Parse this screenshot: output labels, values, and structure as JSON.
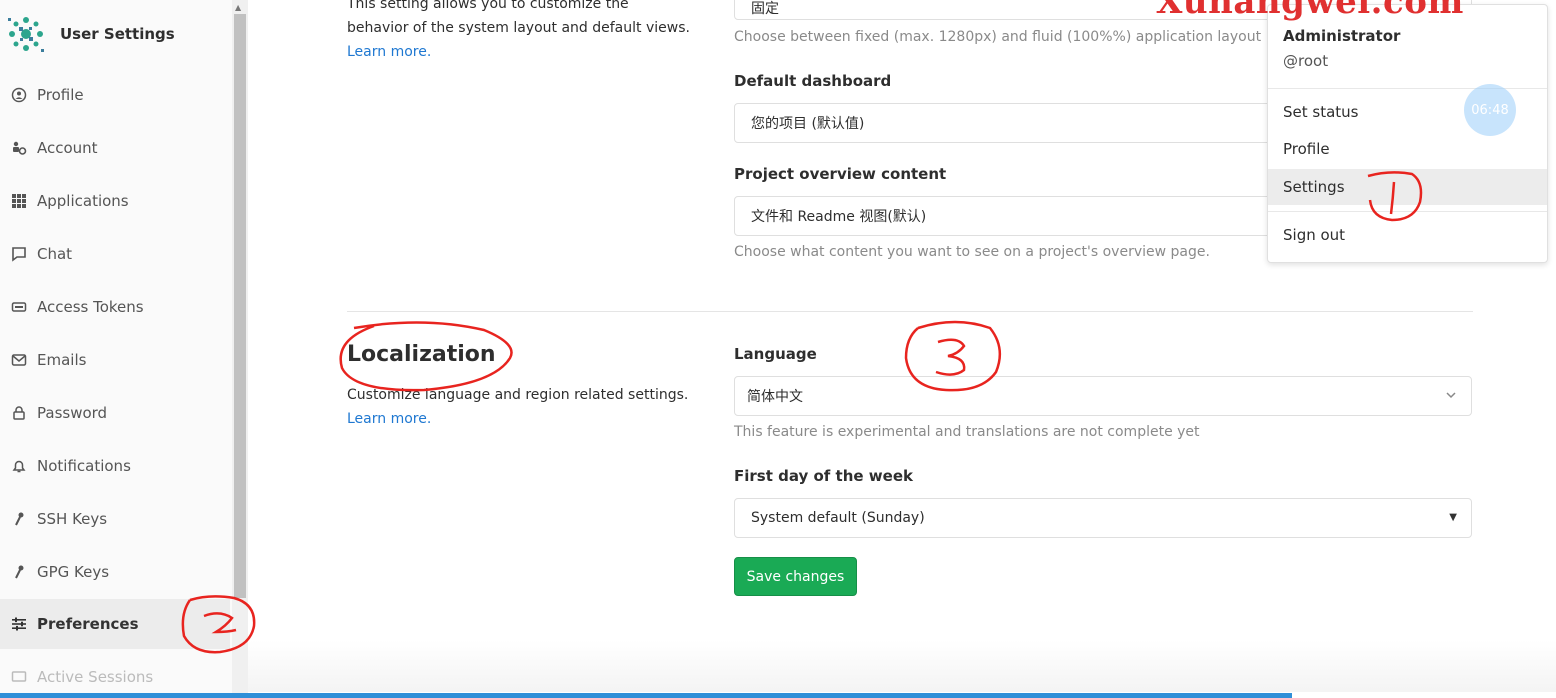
{
  "watermark": "Xunangwei.com",
  "sidebar": {
    "title": "User Settings",
    "items": [
      {
        "label": "Profile",
        "icon": "profile-icon"
      },
      {
        "label": "Account",
        "icon": "account-icon"
      },
      {
        "label": "Applications",
        "icon": "applications-icon"
      },
      {
        "label": "Chat",
        "icon": "chat-icon"
      },
      {
        "label": "Access Tokens",
        "icon": "token-icon"
      },
      {
        "label": "Emails",
        "icon": "email-icon"
      },
      {
        "label": "Password",
        "icon": "lock-icon"
      },
      {
        "label": "Notifications",
        "icon": "bell-icon"
      },
      {
        "label": "SSH Keys",
        "icon": "key-icon"
      },
      {
        "label": "GPG Keys",
        "icon": "key-icon"
      },
      {
        "label": "Preferences",
        "icon": "preferences-icon"
      },
      {
        "label": "Active Sessions",
        "icon": "sessions-icon"
      }
    ],
    "active_item": "Preferences"
  },
  "layout_section": {
    "description_partial_top": "This setting allows you to customize the",
    "description_line2": "behavior of the system layout and default views.",
    "learn_more": "Learn more.",
    "layout_width_value": "固定",
    "layout_width_help": "Choose between fixed (max. 1280px) and fluid (100%%) application layout",
    "default_dashboard_label": "Default dashboard",
    "default_dashboard_value": "您的项目 (默认值)",
    "project_overview_label": "Project overview content",
    "project_overview_value": "文件和 Readme 视图(默认)",
    "project_overview_help": "Choose what content you want to see on a project's overview page."
  },
  "localization": {
    "title": "Localization",
    "description": "Customize language and region related settings.",
    "learn_more": "Learn more.",
    "language_label": "Language",
    "language_value": "简体中文",
    "language_help": "This feature is experimental and translations are not complete yet",
    "first_day_label": "First day of the week",
    "first_day_value": "System default (Sunday)",
    "save_button": "Save changes"
  },
  "user_dropdown": {
    "name": "Administrator",
    "username": "@root",
    "items": [
      "Set status",
      "Profile",
      "Settings",
      "Sign out"
    ],
    "highlighted": "Settings"
  },
  "clock_overlay": "06:48",
  "annotations": {
    "mark_1": "1",
    "mark_2": "2",
    "mark_3": "3",
    "color": "#e8241f"
  },
  "colors": {
    "link": "#1f78d1",
    "save_button": "#1aaa55",
    "sidebar_active_bg": "#ececec"
  }
}
